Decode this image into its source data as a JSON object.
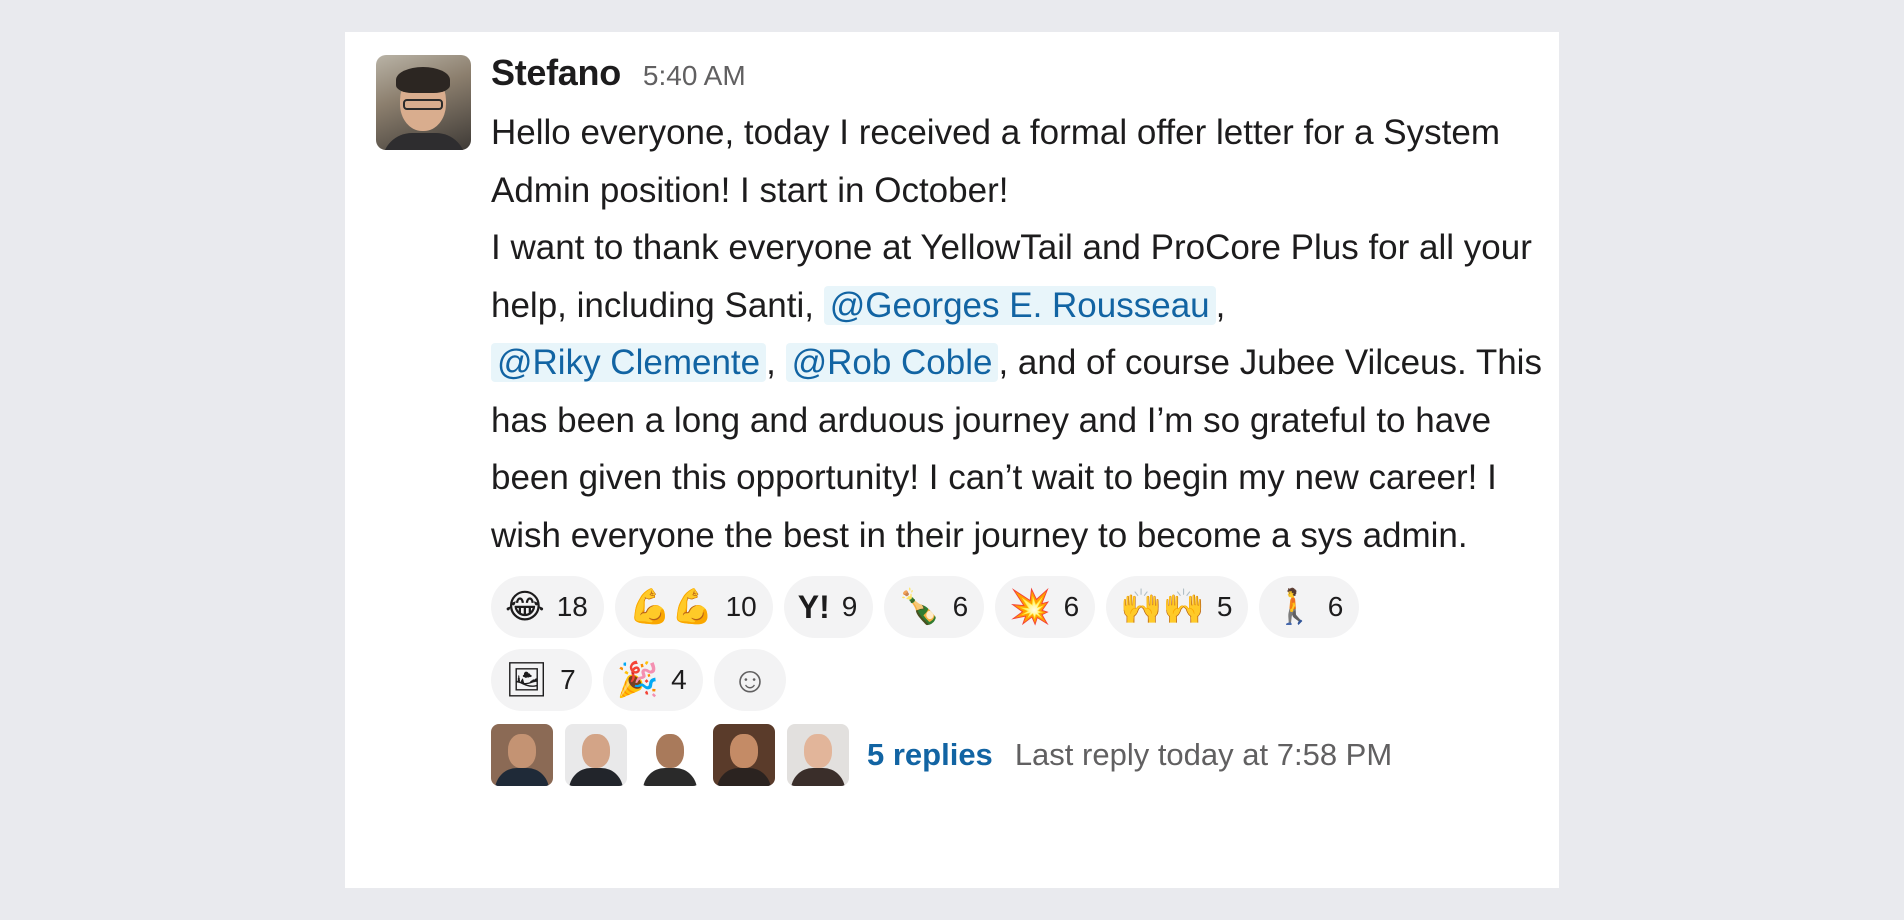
{
  "message": {
    "author": "Stefano",
    "time": "5:40 AM",
    "text_1": "Hello everyone, today I received a formal offer letter for a System Admin position! I start in October!",
    "text_2": "I want to thank everyone at YellowTail and ProCore Plus for all your help, including Santi, ",
    "mention_1": "@Georges E. Rousseau",
    "sep_1": ",",
    "mention_2": "@Riky Clemente",
    "sep_2": ", ",
    "mention_3": "@Rob Coble",
    "text_3": ", and of course Jubee Vilceus. This has been a long and arduous journey and I’m so grateful to have been given this opportunity! I can’t wait to begin my new career! I wish everyone the best in their journey to become a sys admin."
  },
  "reactions": [
    {
      "icon": "joy-emoji",
      "glyph": "😂",
      "count": "18"
    },
    {
      "icon": "muscle-emoji",
      "glyph": "💪💪",
      "count": "10"
    },
    {
      "icon": "yahoo-emoji",
      "glyph": "Y!",
      "count": "9"
    },
    {
      "icon": "champagne-emoji",
      "glyph": "🍾",
      "count": "6"
    },
    {
      "icon": "boom-emoji",
      "glyph": "💥",
      "count": "6"
    },
    {
      "icon": "raised-hands-emoji",
      "glyph": "🙌🙌",
      "count": "5"
    },
    {
      "icon": "walking-emoji",
      "glyph": "🚶",
      "count": "6"
    },
    {
      "icon": "custom-image-emoji",
      "glyph": "🖼",
      "count": "7"
    },
    {
      "icon": "party-hat-emoji",
      "glyph": "🎉",
      "count": "4"
    }
  ],
  "add_reaction": {
    "icon": "add-reaction-icon",
    "glyph": "☺"
  },
  "thread": {
    "replies": "5 replies",
    "last_reply": "Last reply today at 7:58 PM"
  },
  "colors": {
    "link": "#1264a3",
    "mention_bg": "#e8f5fa",
    "page_bg": "#e9eaee"
  }
}
